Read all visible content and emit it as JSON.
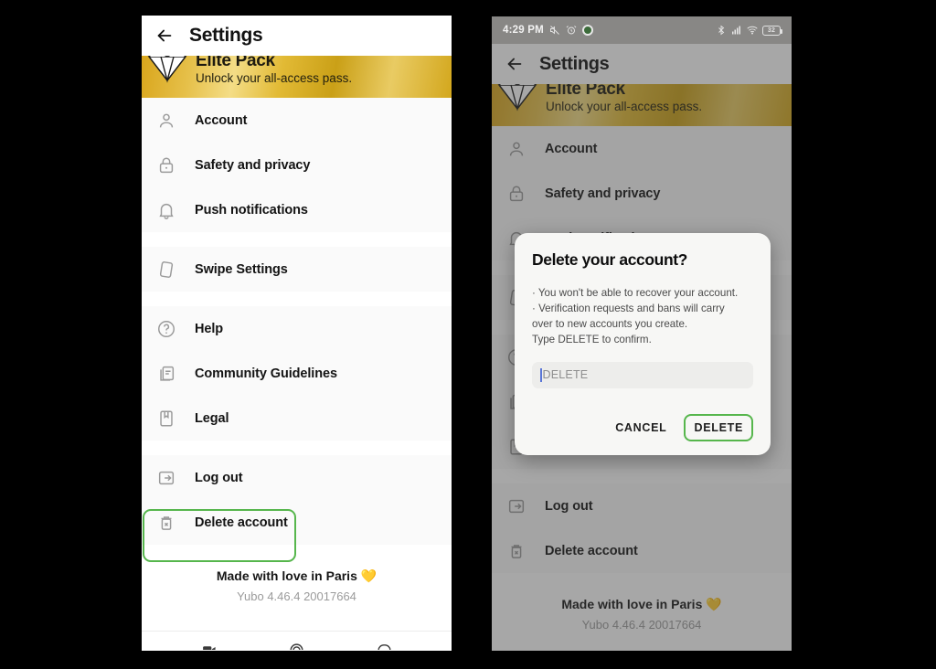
{
  "app": {
    "title": "Settings",
    "back_icon": "back-arrow-icon"
  },
  "status_bar": {
    "time": "4:29 PM",
    "mute_icon": "mute-icon",
    "alarm_icon": "alarm-icon",
    "record_icon": "screen-record-icon",
    "bluetooth_icon": "bluetooth-icon",
    "signal_icon": "cellular-signal-icon",
    "wifi_icon": "wifi-icon",
    "battery_icon": "battery-icon",
    "battery_level": "32"
  },
  "promo_banner": {
    "title": "Elite Pack",
    "subtitle": "Unlock your all-access pass.",
    "icon": "diamond-icon",
    "gold_color": "#e0b02a"
  },
  "menu": {
    "sections": [
      {
        "items": [
          {
            "label": "Account",
            "icon": "person-icon"
          },
          {
            "label": "Safety and privacy",
            "icon": "lock-icon"
          },
          {
            "label": "Push notifications",
            "icon": "bell-icon"
          }
        ]
      },
      {
        "items": [
          {
            "label": "Swipe Settings",
            "icon": "card-swipe-icon"
          }
        ]
      },
      {
        "items": [
          {
            "label": "Help",
            "icon": "question-circle-icon"
          },
          {
            "label": "Community Guidelines",
            "icon": "documents-icon"
          },
          {
            "label": "Legal",
            "icon": "bookmark-book-icon"
          }
        ]
      },
      {
        "items": [
          {
            "label": "Log out",
            "icon": "logout-icon"
          },
          {
            "label": "Delete account",
            "icon": "trash-x-icon"
          }
        ]
      }
    ]
  },
  "footer": {
    "made_with": "Made with love in Paris",
    "heart": "💛",
    "version": "Yubo 4.46.4 20017664"
  },
  "bottom_nav": {
    "items": [
      {
        "icon": "live-icon"
      },
      {
        "icon": "swipe-circle-icon"
      },
      {
        "icon": "chat-icon"
      }
    ]
  },
  "dialog": {
    "title": "Delete your account?",
    "bullets": [
      "· You won't be able to recover your account.",
      "· Verification requests and bans will carry",
      "over to new accounts you create.",
      "Type DELETE to confirm."
    ],
    "input_placeholder": "DELETE",
    "input_value": "",
    "cancel_label": "CANCEL",
    "delete_label": "DELETE"
  },
  "annotations": {
    "highlight_color": "#56b64c",
    "highlight_targets": [
      "Delete account",
      "DELETE"
    ]
  }
}
